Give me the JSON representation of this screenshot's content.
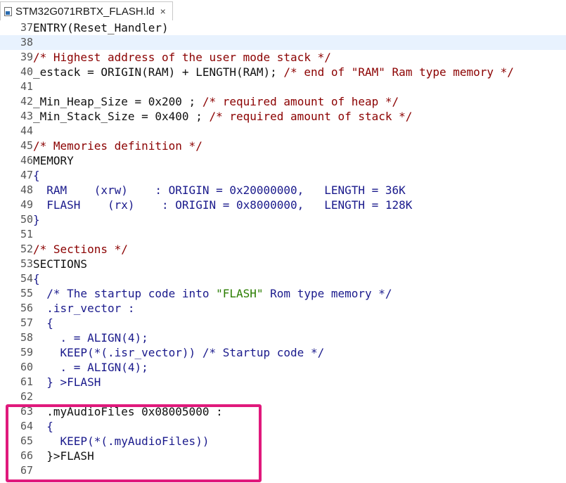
{
  "tab": {
    "title": "STM32G071RBTX_FLASH.ld",
    "close": "×"
  },
  "lines": [
    {
      "n": "37",
      "parts": [
        {
          "t": "ENTRY(Reset_Handler)",
          "c": "plain"
        }
      ]
    },
    {
      "n": "38",
      "current": true,
      "parts": []
    },
    {
      "n": "39",
      "parts": [
        {
          "t": "/* Highest address of the user mode stack */",
          "c": "cm"
        }
      ]
    },
    {
      "n": "40",
      "parts": [
        {
          "t": "_estack = ORIGIN(RAM) + LENGTH(RAM); ",
          "c": "plain"
        },
        {
          "t": "/* end of \"RAM\" Ram type memory */",
          "c": "cm"
        }
      ]
    },
    {
      "n": "41",
      "parts": []
    },
    {
      "n": "42",
      "parts": [
        {
          "t": "_Min_Heap_Size = 0x200 ; ",
          "c": "plain"
        },
        {
          "t": "/* required amount of heap */",
          "c": "cm"
        }
      ]
    },
    {
      "n": "43",
      "parts": [
        {
          "t": "_Min_Stack_Size = 0x400 ; ",
          "c": "plain"
        },
        {
          "t": "/* required amount of stack */",
          "c": "cm"
        }
      ]
    },
    {
      "n": "44",
      "parts": []
    },
    {
      "n": "45",
      "parts": [
        {
          "t": "/* Memories definition */",
          "c": "cm"
        }
      ]
    },
    {
      "n": "46",
      "parts": [
        {
          "t": "MEMORY",
          "c": "plain"
        }
      ]
    },
    {
      "n": "47",
      "parts": [
        {
          "t": "{",
          "c": "kw"
        }
      ]
    },
    {
      "n": "48",
      "parts": [
        {
          "t": "  RAM    (xrw)    : ORIGIN = 0x20000000,   LENGTH = 36K",
          "c": "kw"
        }
      ]
    },
    {
      "n": "49",
      "parts": [
        {
          "t": "  FLASH    (rx)    : ORIGIN = 0x8000000,   LENGTH = 128K",
          "c": "kw"
        }
      ]
    },
    {
      "n": "50",
      "parts": [
        {
          "t": "}",
          "c": "kw"
        }
      ]
    },
    {
      "n": "51",
      "parts": []
    },
    {
      "n": "52",
      "parts": [
        {
          "t": "/* Sections */",
          "c": "cm"
        }
      ]
    },
    {
      "n": "53",
      "parts": [
        {
          "t": "SECTIONS",
          "c": "plain"
        }
      ]
    },
    {
      "n": "54",
      "parts": [
        {
          "t": "{",
          "c": "kw"
        }
      ]
    },
    {
      "n": "55",
      "parts": [
        {
          "t": "  /* The startup code into ",
          "c": "kw"
        },
        {
          "t": "\"FLASH\"",
          "c": "str"
        },
        {
          "t": " Rom type memory */",
          "c": "kw"
        }
      ]
    },
    {
      "n": "56",
      "parts": [
        {
          "t": "  .isr_vector :",
          "c": "kw"
        }
      ]
    },
    {
      "n": "57",
      "parts": [
        {
          "t": "  {",
          "c": "kw"
        }
      ]
    },
    {
      "n": "58",
      "parts": [
        {
          "t": "    . = ALIGN(4);",
          "c": "kw"
        }
      ]
    },
    {
      "n": "59",
      "parts": [
        {
          "t": "    KEEP(*(.isr_vector)) /* Startup code */",
          "c": "kw"
        }
      ]
    },
    {
      "n": "60",
      "parts": [
        {
          "t": "    . = ALIGN(4);",
          "c": "kw"
        }
      ]
    },
    {
      "n": "61",
      "parts": [
        {
          "t": "  } >FLASH",
          "c": "kw"
        }
      ]
    },
    {
      "n": "62",
      "parts": []
    },
    {
      "n": "63",
      "parts": [
        {
          "t": "  .myAudioFiles 0x08005000 :",
          "c": "plain"
        }
      ]
    },
    {
      "n": "64",
      "parts": [
        {
          "t": "  {",
          "c": "kw"
        }
      ]
    },
    {
      "n": "65",
      "parts": [
        {
          "t": "    KEEP(*(.myAudioFiles))",
          "c": "kw"
        }
      ]
    },
    {
      "n": "66",
      "parts": [
        {
          "t": "  }>FLASH",
          "c": "plain"
        }
      ]
    },
    {
      "n": "67",
      "parts": []
    }
  ],
  "colors": {
    "comment": "#8b0000",
    "keyword": "#1a1a8c",
    "string": "#2a7d00",
    "highlight": "#e0197c",
    "current_line": "#e8f2fe"
  },
  "icons": {
    "tab_file": "linker-script-file-icon",
    "tab_close": "close-icon"
  }
}
